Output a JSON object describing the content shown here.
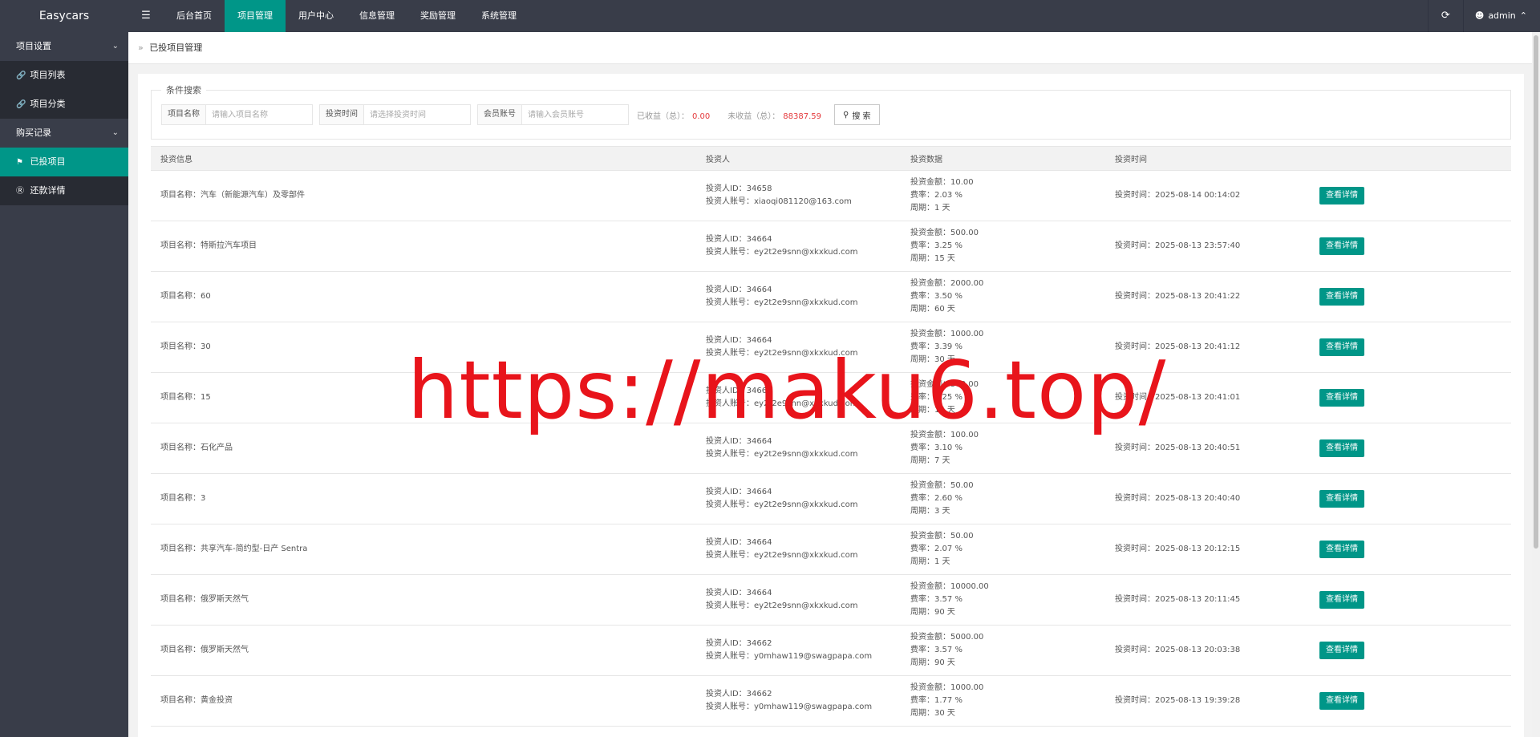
{
  "app": {
    "title": "Easycars"
  },
  "topnav": {
    "toggle_icon": "menu-icon",
    "items": [
      {
        "label": "后台首页",
        "active": false
      },
      {
        "label": "项目管理",
        "active": true
      },
      {
        "label": "用户中心",
        "active": false
      },
      {
        "label": "信息管理",
        "active": false
      },
      {
        "label": "奖励管理",
        "active": false
      },
      {
        "label": "系统管理",
        "active": false
      }
    ],
    "refresh_icon": "refresh-icon",
    "user": "admin"
  },
  "sidebar": {
    "groups": [
      {
        "label": "项目设置",
        "items": [
          {
            "label": "项目列表",
            "icon": "link-icon",
            "active": false
          },
          {
            "label": "项目分类",
            "icon": "link-icon",
            "active": false
          }
        ]
      },
      {
        "label": "购买记录",
        "items": [
          {
            "label": "已投项目",
            "icon": "flag-icon",
            "active": true
          },
          {
            "label": "还款详情",
            "icon": "dollar-circle-icon",
            "active": false
          }
        ]
      }
    ]
  },
  "breadcrumb": {
    "separator": "»",
    "current": "已投项目管理"
  },
  "search": {
    "legend": "条件搜索",
    "project_label": "项目名称",
    "project_placeholder": "请输入项目名称",
    "time_label": "投资时间",
    "time_placeholder": "请选择投资时间",
    "member_label": "会员账号",
    "member_placeholder": "请输入会员账号",
    "earned_label": "已收益（总）：",
    "earned_value": "0.00",
    "unearned_label": "未收益（总）：",
    "unearned_value": "88387.59",
    "button_label": "搜 索"
  },
  "table": {
    "headers": [
      "投资信息",
      "投资人",
      "投资数据",
      "投资时间",
      ""
    ],
    "rows": [
      {
        "name": "项目名称：汽车（新能源汽车）及零部件",
        "investor_id": "投资人ID：34658",
        "investor_account": "投资人账号：xiaoqi081120@163.com",
        "amount": "投资金额：10.00",
        "rate": "费率：2.03 %",
        "period": "周期：1 天",
        "time": "投资时间：2025-08-14 00:14:02",
        "action": "查看详情"
      },
      {
        "name": "项目名称：特斯拉汽车项目",
        "investor_id": "投资人ID：34664",
        "investor_account": "投资人账号：ey2t2e9snn@xkxkud.com",
        "amount": "投资金额：500.00",
        "rate": "费率：3.25 %",
        "period": "周期：15 天",
        "time": "投资时间：2025-08-13 23:57:40",
        "action": "查看详情"
      },
      {
        "name": "项目名称：60",
        "investor_id": "投资人ID：34664",
        "investor_account": "投资人账号：ey2t2e9snn@xkxkud.com",
        "amount": "投资金额：2000.00",
        "rate": "费率：3.50 %",
        "period": "周期：60 天",
        "time": "投资时间：2025-08-13 20:41:22",
        "action": "查看详情"
      },
      {
        "name": "项目名称：30",
        "investor_id": "投资人ID：34664",
        "investor_account": "投资人账号：ey2t2e9snn@xkxkud.com",
        "amount": "投资金额：1000.00",
        "rate": "费率：3.39 %",
        "period": "周期：30 天",
        "time": "投资时间：2025-08-13 20:41:12",
        "action": "查看详情"
      },
      {
        "name": "项目名称：15",
        "investor_id": "投资人ID：34664",
        "investor_account": "投资人账号：ey2t2e9snn@xkxkud.com",
        "amount": "投资金额：500.00",
        "rate": "费率：3.25 %",
        "period": "周期：15 天",
        "time": "投资时间：2025-08-13 20:41:01",
        "action": "查看详情"
      },
      {
        "name": "项目名称：石化产品",
        "investor_id": "投资人ID：34664",
        "investor_account": "投资人账号：ey2t2e9snn@xkxkud.com",
        "amount": "投资金额：100.00",
        "rate": "费率：3.10 %",
        "period": "周期：7 天",
        "time": "投资时间：2025-08-13 20:40:51",
        "action": "查看详情"
      },
      {
        "name": "项目名称：3",
        "investor_id": "投资人ID：34664",
        "investor_account": "投资人账号：ey2t2e9snn@xkxkud.com",
        "amount": "投资金额：50.00",
        "rate": "费率：2.60 %",
        "period": "周期：3 天",
        "time": "投资时间：2025-08-13 20:40:40",
        "action": "查看详情"
      },
      {
        "name": "项目名称：共享汽车-简约型-日产 Sentra",
        "investor_id": "投资人ID：34664",
        "investor_account": "投资人账号：ey2t2e9snn@xkxkud.com",
        "amount": "投资金额：50.00",
        "rate": "费率：2.07 %",
        "period": "周期：1 天",
        "time": "投资时间：2025-08-13 20:12:15",
        "action": "查看详情"
      },
      {
        "name": "项目名称：俄罗斯天然气",
        "investor_id": "投资人ID：34664",
        "investor_account": "投资人账号：ey2t2e9snn@xkxkud.com",
        "amount": "投资金额：10000.00",
        "rate": "费率：3.57 %",
        "period": "周期：90 天",
        "time": "投资时间：2025-08-13 20:11:45",
        "action": "查看详情"
      },
      {
        "name": "项目名称：俄罗斯天然气",
        "investor_id": "投资人ID：34662",
        "investor_account": "投资人账号：y0mhaw119@swagpapa.com",
        "amount": "投资金额：5000.00",
        "rate": "费率：3.57 %",
        "period": "周期：90 天",
        "time": "投资时间：2025-08-13 20:03:38",
        "action": "查看详情"
      },
      {
        "name": "项目名称：黄金投资",
        "investor_id": "投资人ID：34662",
        "investor_account": "投资人账号：y0mhaw119@swagpapa.com",
        "amount": "投资金额：1000.00",
        "rate": "费率：1.77 %",
        "period": "周期：30 天",
        "time": "投资时间：2025-08-13 19:39:28",
        "action": "查看详情"
      }
    ]
  },
  "watermark": "https://maku6.top/",
  "colors": {
    "accent": "#009688",
    "dark": "#393d49",
    "danger": "#e4393c",
    "watermark": "#e8141b"
  }
}
